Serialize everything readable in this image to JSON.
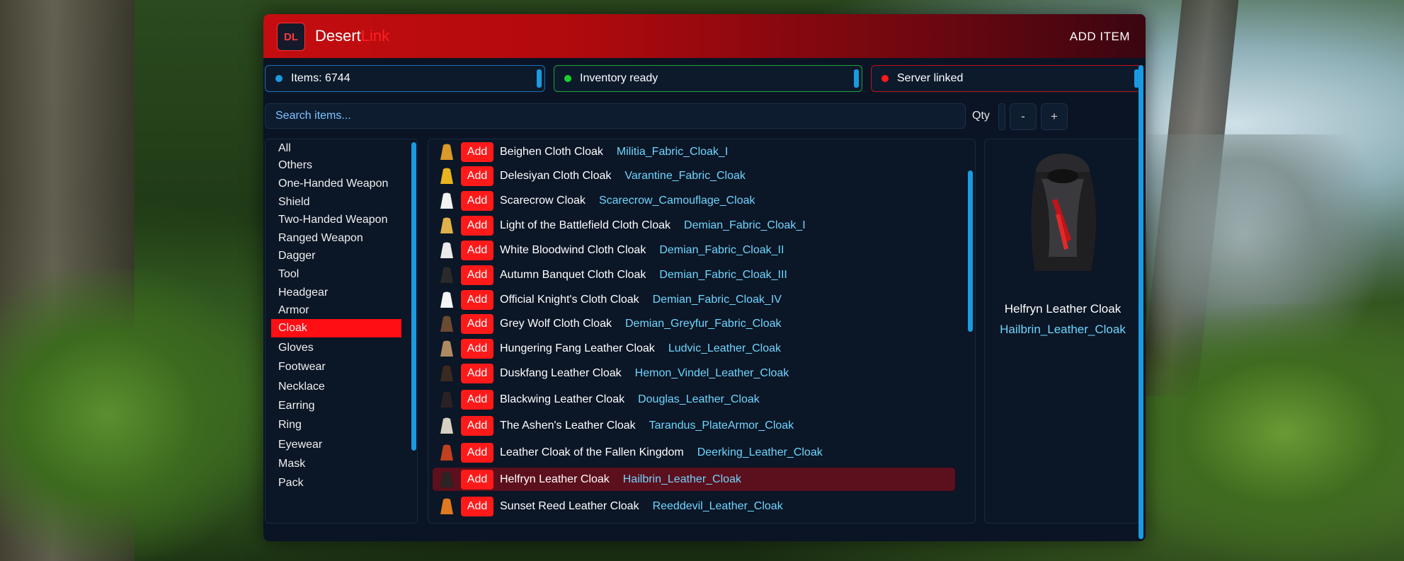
{
  "app": {
    "logo_text": "DL",
    "brand_part1": "Desert",
    "brand_part2": "Link",
    "add_item_label": "ADD  ITEM"
  },
  "status": {
    "items": "Items: 6744",
    "inventory": "Inventory ready",
    "server": "Server linked",
    "colors": {
      "items": "#1a9ae0",
      "inventory": "#19d12c",
      "server": "#ff1a1a"
    }
  },
  "search": {
    "placeholder": "Search items..."
  },
  "qty": {
    "label": "Qty",
    "minus": "-",
    "plus": "+"
  },
  "categories": [
    "All",
    "Others",
    "One-Handed Weapon",
    "Shield",
    "Two-Handed Weapon",
    "Ranged Weapon",
    "Dagger",
    "Tool",
    "Headgear",
    "Armor",
    "Cloak",
    "Gloves",
    "Footwear",
    "Necklace",
    "Earring",
    "Ring",
    "Eyewear",
    "Mask",
    "Pack"
  ],
  "active_category": "Cloak",
  "items": [
    {
      "name": "Beighen Cloth Cloak",
      "code": "Militia_Fabric_Cloak_I",
      "add": "Add",
      "color": "#d99a2a"
    },
    {
      "name": "Delesiyan Cloth Cloak",
      "code": "Varantine_Fabric_Cloak",
      "add": "Add",
      "color": "#e8b420"
    },
    {
      "name": "Scarecrow Cloak",
      "code": "Scarecrow_Camouflage_Cloak",
      "add": "Add",
      "color": "#f2f2f2"
    },
    {
      "name": "Light of the Battlefield Cloth Cloak",
      "code": "Demian_Fabric_Cloak_I",
      "add": "Add",
      "color": "#e0b04a"
    },
    {
      "name": "White Bloodwind Cloth Cloak",
      "code": "Demian_Fabric_Cloak_II",
      "add": "Add",
      "color": "#eaeaea"
    },
    {
      "name": "Autumn Banquet Cloth Cloak",
      "code": "Demian_Fabric_Cloak_III",
      "add": "Add",
      "color": "#2a2a2a"
    },
    {
      "name": "Official Knight's Cloth Cloak",
      "code": "Demian_Fabric_Cloak_IV",
      "add": "Add",
      "color": "#f5f5f5"
    },
    {
      "name": "Grey Wolf Cloth Cloak",
      "code": "Demian_Greyfur_Fabric_Cloak",
      "add": "Add",
      "color": "#6a4a30"
    },
    {
      "name": "Hungering Fang Leather Cloak",
      "code": "Ludvic_Leather_Cloak",
      "add": "Add",
      "color": "#b08a60"
    },
    {
      "name": "Duskfang Leather Cloak",
      "code": "Hemon_Vindel_Leather_Cloak",
      "add": "Add",
      "color": "#3a2a22"
    },
    {
      "name": "Blackwing Leather Cloak",
      "code": "Douglas_Leather_Cloak",
      "add": "Add",
      "color": "#2a2222"
    },
    {
      "name": "The Ashen's Leather Cloak",
      "code": "Tarandus_PlateArmor_Cloak",
      "add": "Add",
      "color": "#d8d0c0"
    },
    {
      "name": "Leather Cloak of the Fallen Kingdom",
      "code": "Deerking_Leather_Cloak",
      "add": "Add",
      "color": "#c04020"
    },
    {
      "name": "Helfryn Leather Cloak",
      "code": "Hailbrin_Leather_Cloak",
      "add": "Add",
      "color": "#2a2424"
    },
    {
      "name": "Sunset Reed Leather Cloak",
      "code": "Reeddevil_Leather_Cloak",
      "add": "Add",
      "color": "#e07a20"
    }
  ],
  "selected_item": {
    "name": "Helfryn Leather Cloak",
    "code": "Hailbrin_Leather_Cloak"
  }
}
